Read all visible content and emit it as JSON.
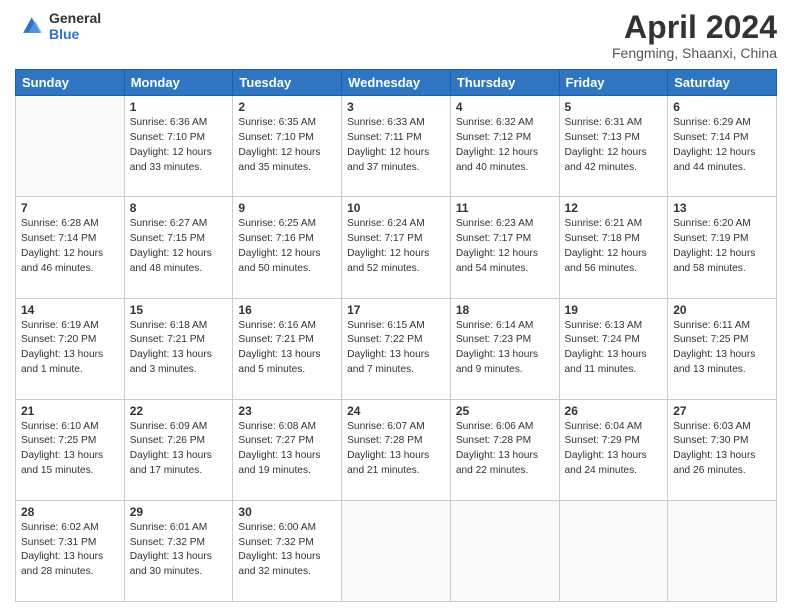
{
  "header": {
    "logo_line1": "General",
    "logo_line2": "Blue",
    "month": "April 2024",
    "location": "Fengming, Shaanxi, China"
  },
  "weekdays": [
    "Sunday",
    "Monday",
    "Tuesday",
    "Wednesday",
    "Thursday",
    "Friday",
    "Saturday"
  ],
  "weeks": [
    [
      {
        "day": "",
        "sunrise": "",
        "sunset": "",
        "daylight": ""
      },
      {
        "day": "1",
        "sunrise": "Sunrise: 6:36 AM",
        "sunset": "Sunset: 7:10 PM",
        "daylight": "Daylight: 12 hours and 33 minutes."
      },
      {
        "day": "2",
        "sunrise": "Sunrise: 6:35 AM",
        "sunset": "Sunset: 7:10 PM",
        "daylight": "Daylight: 12 hours and 35 minutes."
      },
      {
        "day": "3",
        "sunrise": "Sunrise: 6:33 AM",
        "sunset": "Sunset: 7:11 PM",
        "daylight": "Daylight: 12 hours and 37 minutes."
      },
      {
        "day": "4",
        "sunrise": "Sunrise: 6:32 AM",
        "sunset": "Sunset: 7:12 PM",
        "daylight": "Daylight: 12 hours and 40 minutes."
      },
      {
        "day": "5",
        "sunrise": "Sunrise: 6:31 AM",
        "sunset": "Sunset: 7:13 PM",
        "daylight": "Daylight: 12 hours and 42 minutes."
      },
      {
        "day": "6",
        "sunrise": "Sunrise: 6:29 AM",
        "sunset": "Sunset: 7:14 PM",
        "daylight": "Daylight: 12 hours and 44 minutes."
      }
    ],
    [
      {
        "day": "7",
        "sunrise": "Sunrise: 6:28 AM",
        "sunset": "Sunset: 7:14 PM",
        "daylight": "Daylight: 12 hours and 46 minutes."
      },
      {
        "day": "8",
        "sunrise": "Sunrise: 6:27 AM",
        "sunset": "Sunset: 7:15 PM",
        "daylight": "Daylight: 12 hours and 48 minutes."
      },
      {
        "day": "9",
        "sunrise": "Sunrise: 6:25 AM",
        "sunset": "Sunset: 7:16 PM",
        "daylight": "Daylight: 12 hours and 50 minutes."
      },
      {
        "day": "10",
        "sunrise": "Sunrise: 6:24 AM",
        "sunset": "Sunset: 7:17 PM",
        "daylight": "Daylight: 12 hours and 52 minutes."
      },
      {
        "day": "11",
        "sunrise": "Sunrise: 6:23 AM",
        "sunset": "Sunset: 7:17 PM",
        "daylight": "Daylight: 12 hours and 54 minutes."
      },
      {
        "day": "12",
        "sunrise": "Sunrise: 6:21 AM",
        "sunset": "Sunset: 7:18 PM",
        "daylight": "Daylight: 12 hours and 56 minutes."
      },
      {
        "day": "13",
        "sunrise": "Sunrise: 6:20 AM",
        "sunset": "Sunset: 7:19 PM",
        "daylight": "Daylight: 12 hours and 58 minutes."
      }
    ],
    [
      {
        "day": "14",
        "sunrise": "Sunrise: 6:19 AM",
        "sunset": "Sunset: 7:20 PM",
        "daylight": "Daylight: 13 hours and 1 minute."
      },
      {
        "day": "15",
        "sunrise": "Sunrise: 6:18 AM",
        "sunset": "Sunset: 7:21 PM",
        "daylight": "Daylight: 13 hours and 3 minutes."
      },
      {
        "day": "16",
        "sunrise": "Sunrise: 6:16 AM",
        "sunset": "Sunset: 7:21 PM",
        "daylight": "Daylight: 13 hours and 5 minutes."
      },
      {
        "day": "17",
        "sunrise": "Sunrise: 6:15 AM",
        "sunset": "Sunset: 7:22 PM",
        "daylight": "Daylight: 13 hours and 7 minutes."
      },
      {
        "day": "18",
        "sunrise": "Sunrise: 6:14 AM",
        "sunset": "Sunset: 7:23 PM",
        "daylight": "Daylight: 13 hours and 9 minutes."
      },
      {
        "day": "19",
        "sunrise": "Sunrise: 6:13 AM",
        "sunset": "Sunset: 7:24 PM",
        "daylight": "Daylight: 13 hours and 11 minutes."
      },
      {
        "day": "20",
        "sunrise": "Sunrise: 6:11 AM",
        "sunset": "Sunset: 7:25 PM",
        "daylight": "Daylight: 13 hours and 13 minutes."
      }
    ],
    [
      {
        "day": "21",
        "sunrise": "Sunrise: 6:10 AM",
        "sunset": "Sunset: 7:25 PM",
        "daylight": "Daylight: 13 hours and 15 minutes."
      },
      {
        "day": "22",
        "sunrise": "Sunrise: 6:09 AM",
        "sunset": "Sunset: 7:26 PM",
        "daylight": "Daylight: 13 hours and 17 minutes."
      },
      {
        "day": "23",
        "sunrise": "Sunrise: 6:08 AM",
        "sunset": "Sunset: 7:27 PM",
        "daylight": "Daylight: 13 hours and 19 minutes."
      },
      {
        "day": "24",
        "sunrise": "Sunrise: 6:07 AM",
        "sunset": "Sunset: 7:28 PM",
        "daylight": "Daylight: 13 hours and 21 minutes."
      },
      {
        "day": "25",
        "sunrise": "Sunrise: 6:06 AM",
        "sunset": "Sunset: 7:28 PM",
        "daylight": "Daylight: 13 hours and 22 minutes."
      },
      {
        "day": "26",
        "sunrise": "Sunrise: 6:04 AM",
        "sunset": "Sunset: 7:29 PM",
        "daylight": "Daylight: 13 hours and 24 minutes."
      },
      {
        "day": "27",
        "sunrise": "Sunrise: 6:03 AM",
        "sunset": "Sunset: 7:30 PM",
        "daylight": "Daylight: 13 hours and 26 minutes."
      }
    ],
    [
      {
        "day": "28",
        "sunrise": "Sunrise: 6:02 AM",
        "sunset": "Sunset: 7:31 PM",
        "daylight": "Daylight: 13 hours and 28 minutes."
      },
      {
        "day": "29",
        "sunrise": "Sunrise: 6:01 AM",
        "sunset": "Sunset: 7:32 PM",
        "daylight": "Daylight: 13 hours and 30 minutes."
      },
      {
        "day": "30",
        "sunrise": "Sunrise: 6:00 AM",
        "sunset": "Sunset: 7:32 PM",
        "daylight": "Daylight: 13 hours and 32 minutes."
      },
      {
        "day": "",
        "sunrise": "",
        "sunset": "",
        "daylight": ""
      },
      {
        "day": "",
        "sunrise": "",
        "sunset": "",
        "daylight": ""
      },
      {
        "day": "",
        "sunrise": "",
        "sunset": "",
        "daylight": ""
      },
      {
        "day": "",
        "sunrise": "",
        "sunset": "",
        "daylight": ""
      }
    ]
  ]
}
